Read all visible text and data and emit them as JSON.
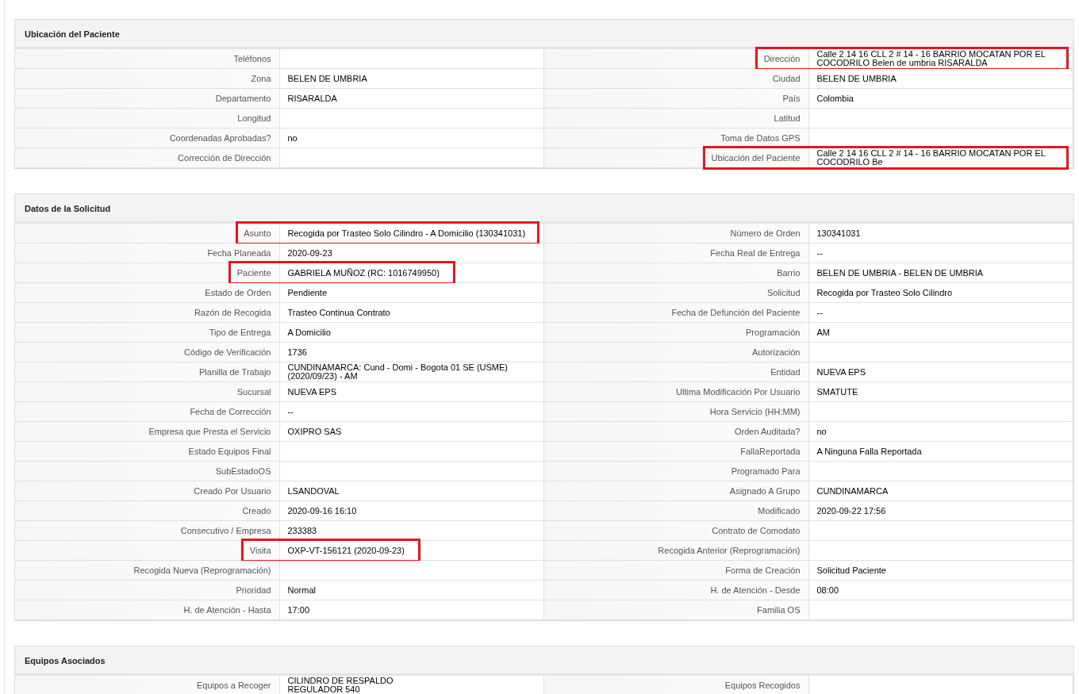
{
  "sections": [
    {
      "title": "Ubicación del Paciente",
      "fields": [
        {
          "label": "Teléfonos",
          "highlighted": false
        },
        {
          "label": "Dirección",
          "value": "Calle 2 14 16 CLL 2 # 14 - 16 BARRIO MOCATAN POR EL COCODRILO Belen de umbria RISARALDA",
          "highlighted": true
        },
        {
          "label": "Zona",
          "value": "BELEN DE UMBRIA",
          "highlighted": false
        },
        {
          "label": "Ciudad",
          "value": "BELEN DE UMBRIA",
          "highlighted": false
        },
        {
          "label": "Departamento",
          "value": "RISARALDA",
          "highlighted": false
        },
        {
          "label": "País",
          "value": "Colombia",
          "highlighted": false
        },
        {
          "label": "Longitud",
          "highlighted": false
        },
        {
          "label": "Latitud",
          "highlighted": false
        },
        {
          "label": "Coordenadas Aprobadas?",
          "value": "no",
          "highlighted": false
        },
        {
          "label": "Toma de Datos GPS",
          "highlighted": false
        },
        {
          "label": "Corrección de Dirección",
          "highlighted": false
        },
        {
          "label": "Ubicación del Paciente",
          "value": "Calle 2 14 16 CLL 2 # 14 - 16 BARRIO MOCATAN POR EL COCODRILO Be",
          "highlighted": true
        }
      ]
    },
    {
      "title": "Datos de la Solicitud",
      "fields": [
        {
          "label": "Asunto",
          "value": "Recogida por Trasteo Solo Cilindro - A Domicilio (130341031)",
          "highlighted": true
        },
        {
          "label": "Número de Orden",
          "value": "130341031",
          "highlighted": false
        },
        {
          "label": "Fecha Planeada",
          "value": "2020-09-23",
          "highlighted": false
        },
        {
          "label": "Fecha Real de Entrega",
          "value": "--",
          "highlighted": false
        },
        {
          "label": "Paciente",
          "value": "GABRIELA MUÑOZ (RC: 1016749950)",
          "highlighted": true
        },
        {
          "label": "Barrio",
          "value": "BELEN DE UMBRIA - BELEN DE UMBRIA",
          "highlighted": false
        },
        {
          "label": "Estado de Orden",
          "value": "Pendiente",
          "highlighted": false
        },
        {
          "label": "Solicitud",
          "value": "Recogida por Trasteo Solo Cilindro",
          "highlighted": false
        },
        {
          "label": "Razón de Recogida",
          "value": "Trasteo Continua Contrato",
          "highlighted": false
        },
        {
          "label": "Fecha de Defunción del Paciente",
          "value": "--",
          "highlighted": false
        },
        {
          "label": "Tipo de Entrega",
          "value": "A Domicilio",
          "highlighted": false
        },
        {
          "label": "Programación",
          "value": "AM",
          "highlighted": false
        },
        {
          "label": "Código de Verificación",
          "value": "1736",
          "highlighted": false
        },
        {
          "label": "Autorización",
          "highlighted": false
        },
        {
          "label": "Planilla de Trabajo",
          "value": "CUNDINAMARCA: Cund - Domi - Bogota 01 SE (USME)\n(2020/09/23) - AM",
          "highlighted": false
        },
        {
          "label": "Entidad",
          "value": "NUEVA EPS",
          "highlighted": false
        },
        {
          "label": "Sucursal",
          "value": "NUEVA EPS",
          "highlighted": false
        },
        {
          "label": "Ultima Modificación Por Usuario",
          "value": "SMATUTE",
          "highlighted": false
        },
        {
          "label": "Fecha de Corrección",
          "value": "--",
          "highlighted": false
        },
        {
          "label": "Hora Servicio (HH:MM)",
          "highlighted": false
        },
        {
          "label": "Empresa que Presta el Servicio",
          "value": "OXIPRO SAS",
          "highlighted": false
        },
        {
          "label": "Orden Auditada?",
          "value": "no",
          "highlighted": false
        },
        {
          "label": "Estado Equipos Final",
          "highlighted": false
        },
        {
          "label": "FallaReportada",
          "value": "A Ninguna Falla Reportada",
          "highlighted": false
        },
        {
          "label": "SubEstadoOS",
          "highlighted": false
        },
        {
          "label": "Programado Para",
          "highlighted": false
        },
        {
          "label": "Creado Por Usuario",
          "value": "LSANDOVAL",
          "highlighted": false
        },
        {
          "label": "Asignado A Grupo",
          "value": "CUNDINAMARCA",
          "highlighted": false
        },
        {
          "label": "Creado",
          "value": "2020-09-16 16:10",
          "highlighted": false
        },
        {
          "label": "Modificado",
          "value": "2020-09-22 17:56",
          "highlighted": false
        },
        {
          "label": "Consecutivo / Empresa",
          "value": "233383",
          "highlighted": false
        },
        {
          "label": "Contrato de Comodato",
          "highlighted": false
        },
        {
          "label": "Visita",
          "value": "OXP-VT-156121 (2020-09-23)",
          "highlighted": true
        },
        {
          "label": "Recogida Anterior (Reprogramación)",
          "highlighted": false
        },
        {
          "label": "Recogida Nueva (Reprogramación)",
          "highlighted": false
        },
        {
          "label": "Forma de Creación",
          "value": "Solicitud Paciente",
          "highlighted": false
        },
        {
          "label": "Prioridad",
          "value": "Normal",
          "highlighted": false
        },
        {
          "label": "H. de Atención - Desde",
          "value": "08:00",
          "highlighted": false
        },
        {
          "label": "H. de Atención - Hasta",
          "value": "17:00",
          "highlighted": false
        },
        {
          "label": "Familia OS",
          "highlighted": false
        }
      ]
    },
    {
      "title": "Equipos Asociados",
      "fields": [
        {
          "label": "Equipos a Recoger",
          "value": "CILINDRO DE RESPALDO\nREGULADOR 540",
          "highlighted": false
        },
        {
          "label": "Equipos Recogidos",
          "highlighted": false
        }
      ]
    }
  ]
}
